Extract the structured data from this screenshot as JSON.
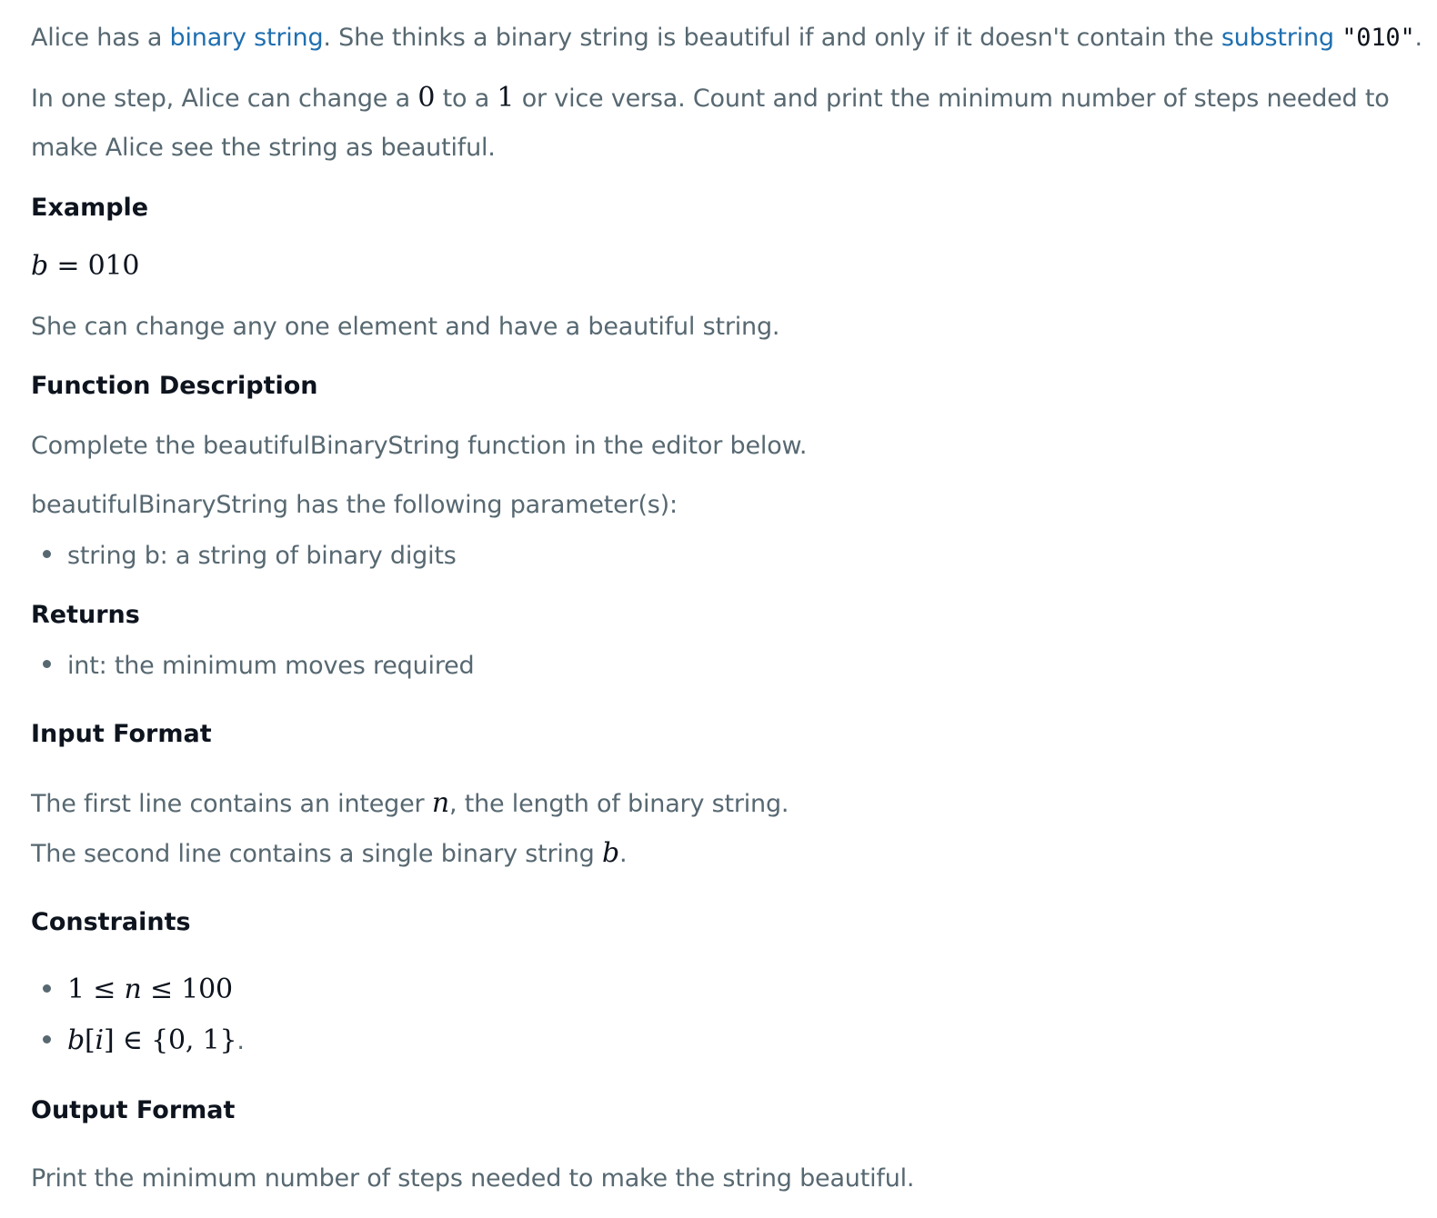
{
  "intro": {
    "p1_a": "Alice has a ",
    "p1_link1": "binary string",
    "p1_b": ". She thinks a binary string is beautiful if and only if it doesn't contain the ",
    "p1_link2": "substring",
    "p1_code": "\"010\"",
    "p1_c": ".",
    "p2_a": "In one step, Alice can change a ",
    "p2_zero": "0",
    "p2_b": " to a ",
    "p2_one": "1",
    "p2_c": " or vice versa. Count and print the minimum number of steps needed to",
    "p2_d": "make Alice see the string as beautiful."
  },
  "example": {
    "heading": "Example",
    "var": "b",
    "eq": " = 010",
    "text": "She can change any one element and have a beautiful string."
  },
  "function_description": {
    "heading": "Function Description",
    "text": "Complete the beautifulBinaryString function in the editor below.",
    "params_intro": "beautifulBinaryString has the following parameter(s):",
    "param": "string b: a string of binary digits"
  },
  "returns": {
    "heading": "Returns",
    "item": "int: the minimum moves required"
  },
  "input_format": {
    "heading": "Input Format",
    "line1_a": "The first line contains an integer ",
    "line1_var": "n",
    "line1_b": ", the length of binary string.",
    "line2_a": "The second line contains a single binary string ",
    "line2_var": "b",
    "line2_b": "."
  },
  "constraints": {
    "heading": "Constraints",
    "c1_a": "1 ≤ ",
    "c1_var": "n",
    "c1_b": " ≤ 100",
    "c2_var1": "b",
    "c2_a": "[",
    "c2_var2": "i",
    "c2_b": "] ∈ {0, 1}",
    "c2_c": "."
  },
  "output_format": {
    "heading": "Output Format",
    "text": "Print the minimum number of steps needed to make the string beautiful."
  }
}
